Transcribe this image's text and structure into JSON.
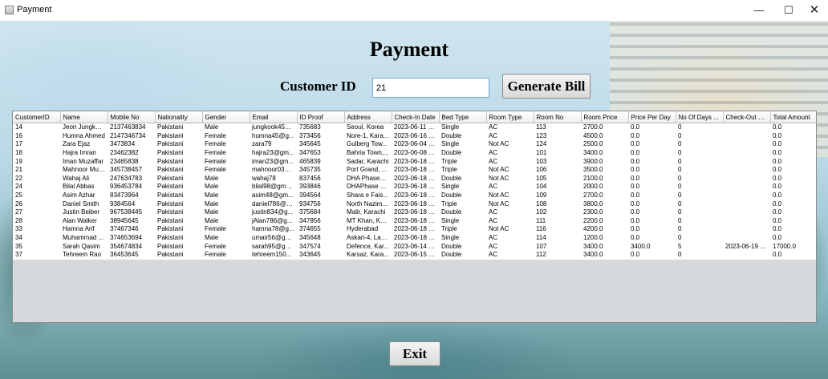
{
  "window": {
    "title": "Payment",
    "min_glyph": "—",
    "max_glyph": "☐",
    "close_glyph": "✕"
  },
  "header": {
    "title": "Payment"
  },
  "form": {
    "customer_id_label": "Customer ID",
    "customer_id_value": "21",
    "generate_label": "Generate Bill"
  },
  "table": {
    "columns": [
      "CustomerID",
      "Name",
      "Mobile No",
      "Nationality",
      "Gender",
      "Email",
      "ID Proof",
      "Address",
      "Check-In Date",
      "Bed Type",
      "Room Type",
      "Room No",
      "Room Price",
      "Price Per Day",
      "No Of Days ...",
      "Check-Out D...",
      "Total Amount"
    ],
    "rows": [
      [
        "14",
        "Jeon Jungkook",
        "2137463834",
        "Pakistani",
        "Male",
        "jungkook45@...",
        "735683",
        "Seoul, Korea",
        "2023-06-11 0...",
        "Single",
        "AC",
        "113",
        "2700.0",
        "0.0",
        "0",
        "",
        "0.0"
      ],
      [
        "16",
        "Humna Ahmed",
        "2147346734",
        "Pakistani",
        "Female",
        "humna45@g...",
        "373456",
        "Nore-1, Kara...",
        "2023-06-16 0...",
        "Double",
        "AC",
        "123",
        "4500.0",
        "0.0",
        "0",
        "",
        "0.0"
      ],
      [
        "17",
        "Zara Ejaz",
        "3473834",
        "Pakistani",
        "Female",
        "zara79",
        "345645",
        "Gulberg Tow...",
        "2023-06-04 0...",
        "Single",
        "Not AC",
        "124",
        "2500.0",
        "0.0",
        "0",
        "",
        "0.0"
      ],
      [
        "18",
        "Hajra Imran",
        "23462382",
        "Pakistani",
        "Female",
        "hajra23@gm...",
        "347653",
        "Bahria Town,...",
        "2023-06-08 1...",
        "Double",
        "AC",
        "101",
        "3400.0",
        "0.0",
        "0",
        "",
        "0.0"
      ],
      [
        "19",
        "Iman Muzaffar",
        "23465838",
        "Pakistani",
        "Female",
        "iman23@gm...",
        "465839",
        "Sadar, Karachi",
        "2023-06-18 1...",
        "Triple",
        "AC",
        "103",
        "3900.0",
        "0.0",
        "0",
        "",
        "0.0"
      ],
      [
        "21",
        "Mahnoor Muz...",
        "345738457",
        "Pakistani",
        "Female",
        "mahnoor03@...",
        "345735",
        "Port Grand, ...",
        "2023-06-18 1...",
        "Triple",
        "Not AC",
        "106",
        "3500.0",
        "0.0",
        "0",
        "",
        "0.0"
      ],
      [
        "22",
        "Wahaj Ali",
        "247634783",
        "Pakistani",
        "Male",
        "wahaj78",
        "837456",
        "DHA Phase1,...",
        "2023-06-18 1...",
        "Double",
        "Not AC",
        "105",
        "2100.0",
        "0.0",
        "0",
        "",
        "0.0"
      ],
      [
        "24",
        "Bilal Abbas",
        "936453784",
        "Pakistani",
        "Male",
        "bilal98@gmail...",
        "393846",
        "DHAPhase 8,...",
        "2023-06-18 1...",
        "Single",
        "AC",
        "104",
        "2000.0",
        "0.0",
        "0",
        "",
        "0.0"
      ],
      [
        "25",
        "Asim Azhar",
        "83473964",
        "Pakistani",
        "Male",
        "asim48@gm...",
        "394564",
        "Shara e Fais...",
        "2023-06-18 1...",
        "Double",
        "Not AC",
        "109",
        "2700.0",
        "0.0",
        "0",
        "",
        "0.0"
      ],
      [
        "26",
        "Daniel Smith",
        "9384564",
        "Pakistani",
        "Male",
        "daniel786@g...",
        "934756",
        "North Nazima...",
        "2023-06-18 1...",
        "Triple",
        "Not AC",
        "108",
        "3800.0",
        "0.0",
        "0",
        "",
        "0.0"
      ],
      [
        "27",
        "Justin Beiber",
        "967538445",
        "Pakistani",
        "Male",
        "justin834@g...",
        "375684",
        "Malir, Karachi",
        "2023-06-18 1...",
        "Double",
        "AC",
        "102",
        "2300.0",
        "0.0",
        "0",
        "",
        "0.0"
      ],
      [
        "28",
        "Alan Walker",
        "38945645",
        "Pakistani",
        "Male",
        "jAlan786@g...",
        "347856",
        "MT Khan, Ka...",
        "2023-06-18 1...",
        "Single",
        "AC",
        "111",
        "2200.0",
        "0.0",
        "0",
        "",
        "0.0"
      ],
      [
        "33",
        "Hamna Arif",
        "37467346",
        "Pakistani",
        "Female",
        "hamna78@g...",
        "374655",
        "Hyderabad",
        "2023-06-18 1...",
        "Triple",
        "Not AC",
        "116",
        "4200.0",
        "0.0",
        "0",
        "",
        "0.0"
      ],
      [
        "34",
        "Muhammad ...",
        "374653694",
        "Pakistani",
        "Male",
        "umair56@gm...",
        "345648",
        "Askari-4, Lah...",
        "2023-06-18 1...",
        "Single",
        "AC",
        "114",
        "1200.0",
        "0.0",
        "0",
        "",
        "0.0"
      ],
      [
        "35",
        "Sarah Qasim",
        "354674834",
        "Pakistani",
        "Female",
        "sarah95@gm...",
        "347574",
        "Defence, Kar...",
        "2023-06-14 0...",
        "Double",
        "AC",
        "107",
        "3400.0",
        "3400.0",
        "5",
        "2023-06-19 0...",
        "17000.0"
      ],
      [
        "37",
        "Tehreem Rao",
        "36453645",
        "Pakistani",
        "Female",
        "tehreem150...",
        "343645",
        "Karsaz, Kara...",
        "2023-06-15 0...",
        "Double",
        "AC",
        "112",
        "3400.0",
        "0.0",
        "0",
        "",
        "0.0"
      ]
    ]
  },
  "footer": {
    "exit_label": "Exit"
  }
}
